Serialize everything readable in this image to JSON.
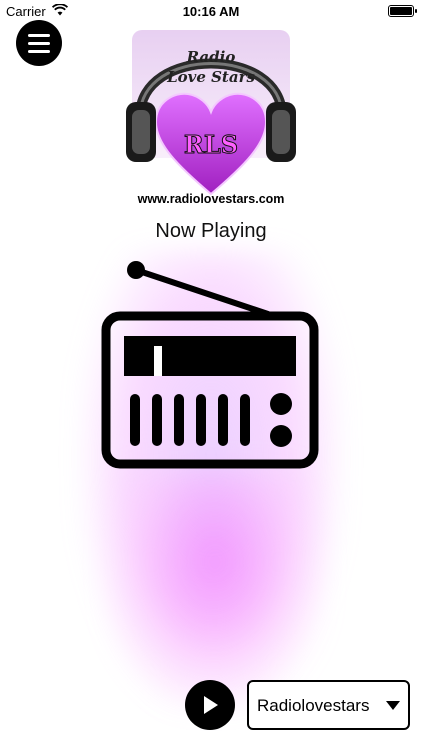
{
  "status_bar": {
    "carrier": "Carrier",
    "time": "10:16 AM",
    "icons": [
      "wifi-icon",
      "battery-icon"
    ]
  },
  "menu": {
    "icon": "hamburger-menu-icon"
  },
  "logo": {
    "line1": "Radio",
    "line2": "Love Stars",
    "abbr": "RLS",
    "url": "www.radiolovestars.com"
  },
  "player": {
    "now_playing_label": "Now Playing",
    "artwork_icon": "radio-icon",
    "play_icon": "play-icon"
  },
  "station_select": {
    "selected": "Radiolovestars",
    "icon": "chevron-down-icon"
  },
  "colors": {
    "accent": "#000000",
    "logo_heart": "#c040e0",
    "glow": "#f080ff",
    "background": "#ffffff"
  }
}
